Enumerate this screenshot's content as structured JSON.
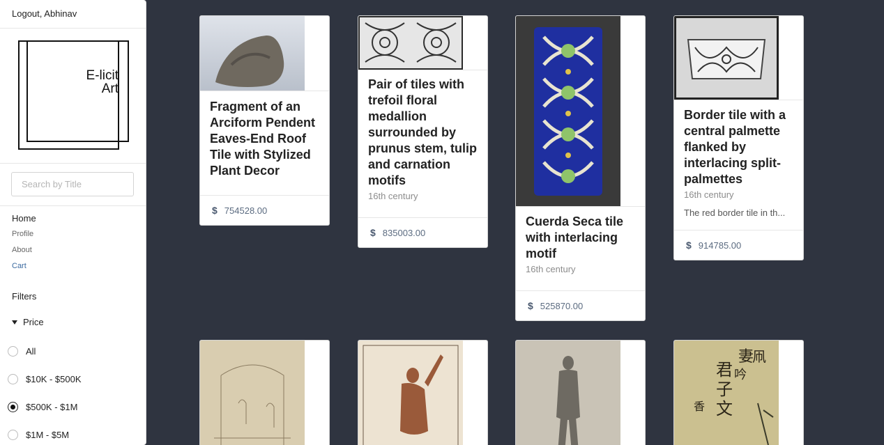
{
  "sidebar": {
    "logout": "Logout, Abhinav",
    "logo": {
      "line1": "E-licit",
      "line2": "Art"
    },
    "search_placeholder": "Search by Title",
    "menu": {
      "home": "Home",
      "profile": "Profile",
      "about": "About",
      "cart": "Cart"
    },
    "filters_title": "Filters",
    "price_title": "Price",
    "price_options": [
      {
        "label": "All",
        "selected": false
      },
      {
        "label": "$10K - $500K",
        "selected": false
      },
      {
        "label": "$500K - $1M",
        "selected": true
      },
      {
        "label": "$1M - $5M",
        "selected": false
      }
    ]
  },
  "cards": [
    {
      "title": "Fragment of an Arciform Pendent Eaves-End Roof Tile with Stylized Plant Decor",
      "subtitle": "",
      "description": "",
      "price": "754528.00"
    },
    {
      "title": "Pair of tiles with trefoil floral medallion surrounded by prunus stem, tulip and carnation motifs",
      "subtitle": "16th century",
      "description": "",
      "price": "835003.00"
    },
    {
      "title": "Cuerda Seca tile with interlacing motif",
      "subtitle": "16th century",
      "description": "",
      "price": "525870.00"
    },
    {
      "title": "Border tile with a central palmette flanked by interlacing split-palmettes",
      "subtitle": "16th century",
      "description": "The red border tile in th...",
      "price": "914785.00"
    }
  ],
  "colors": {
    "background": "#2f3440",
    "price_text": "#5b6b80",
    "active_link": "#3b6aa0"
  }
}
